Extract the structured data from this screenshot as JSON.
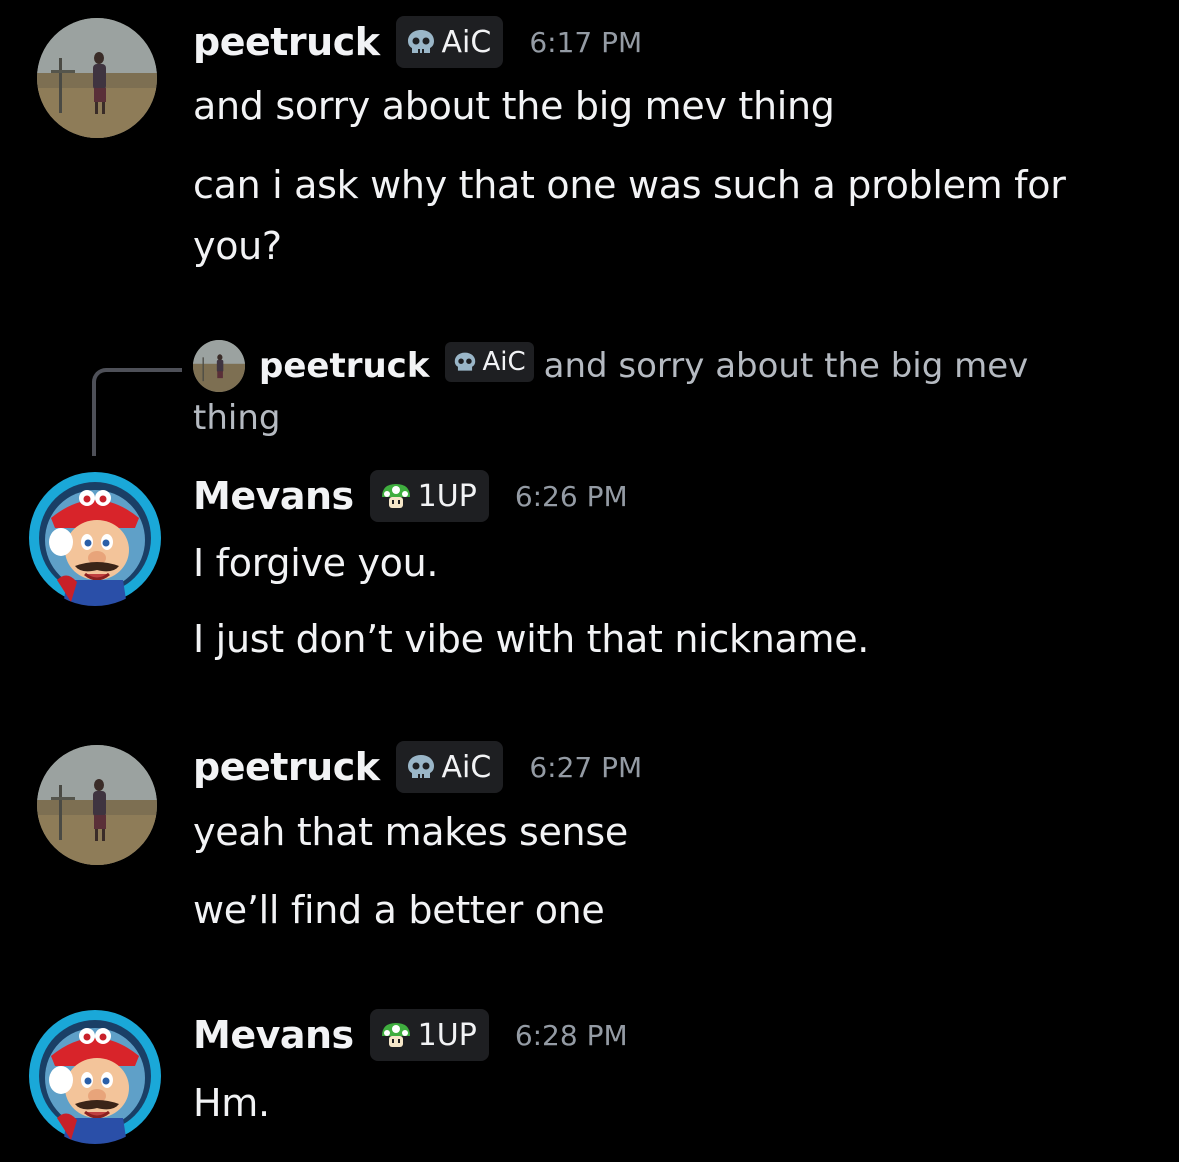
{
  "messages": [
    {
      "username": "peetruck",
      "tag": {
        "label": "AiC",
        "icon": "skull-icon"
      },
      "time": "6:17 PM",
      "lines": [
        "and sorry about the big mev thing",
        "can i ask why that one was such a problem for",
        "you?"
      ]
    },
    {
      "reply": {
        "username": "peetruck",
        "tag": {
          "label": "AiC",
          "icon": "skull-icon"
        },
        "text": "and sorry about the big mev thing"
      },
      "username": "Mevans",
      "tag": {
        "label": "1UP",
        "icon": "mushroom-icon"
      },
      "time": "6:26 PM",
      "lines": [
        "I forgive you.",
        "I just don’t vibe with that nickname."
      ]
    },
    {
      "username": "peetruck",
      "tag": {
        "label": "AiC",
        "icon": "skull-icon"
      },
      "time": "6:27 PM",
      "lines": [
        "yeah that makes sense",
        "we’ll find a better one"
      ]
    },
    {
      "username": "Mevans",
      "tag": {
        "label": "1UP",
        "icon": "mushroom-icon"
      },
      "time": "6:28 PM",
      "lines": [
        "Hm."
      ]
    }
  ],
  "colors": {
    "background": "#000000",
    "text": "#f2f3f5",
    "muted": "#949ba4",
    "tag_bg": "#1e1f22"
  }
}
